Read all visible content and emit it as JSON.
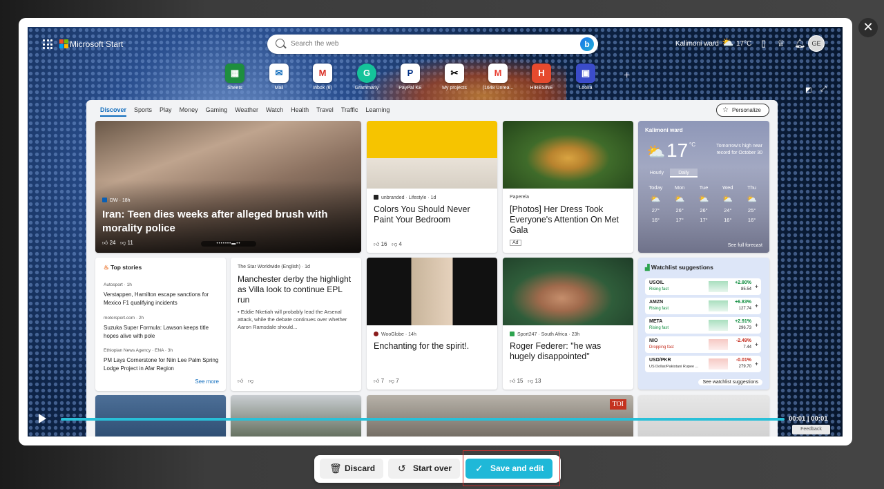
{
  "modal": {
    "close": "✕"
  },
  "topbar": {
    "brand": "Microsoft Start",
    "search_placeholder": "Search the web",
    "location": "Kalimoni ward",
    "temp": "17°C",
    "avatar": "GE"
  },
  "apps": [
    {
      "label": "Sheets",
      "glyph": "▦",
      "color": "#1e8e3e",
      "bg": "#fff"
    },
    {
      "label": "Mail",
      "glyph": "✉",
      "color": "#0f6cbd",
      "bg": "#fff"
    },
    {
      "label": "Inbox (6)",
      "glyph": "M",
      "color": "#d93025",
      "bg": "#fff"
    },
    {
      "label": "Grammarly",
      "glyph": "G",
      "color": "#fff",
      "bg": "#15c39a"
    },
    {
      "label": "PayPal KE",
      "glyph": "P",
      "color": "#003087",
      "bg": "#fff"
    },
    {
      "label": "My projects",
      "glyph": "✂",
      "color": "#000",
      "bg": "#fff"
    },
    {
      "label": "(1648 Unrea...",
      "glyph": "M",
      "color": "#e94235",
      "bg": "#fff"
    },
    {
      "label": "HIRESINE",
      "glyph": "H",
      "color": "#fff",
      "bg": "#e64a2e"
    },
    {
      "label": "Looka",
      "glyph": "▣",
      "color": "#fff",
      "bg": "#3b4cca"
    }
  ],
  "nav": {
    "tabs": [
      "Discover",
      "Sports",
      "Play",
      "Money",
      "Gaming",
      "Weather",
      "Watch",
      "Health",
      "Travel",
      "Traffic",
      "Learning"
    ],
    "personalize": "Personalize"
  },
  "hero": {
    "source": "DW · 18h",
    "title": "Iran: Teen dies weeks after alleged brush with morality police",
    "likes": "24",
    "dislikes": "11"
  },
  "cards": [
    {
      "source": "unbranded · Lifestyle · 1d",
      "title": "Colors You Should Never Paint Your Bedroom",
      "likes": "16",
      "dislikes": "4"
    },
    {
      "source": "Paperela",
      "title": "[Photos] Her Dress Took Everyone's Attention On Met Gala",
      "ad": "Ad"
    },
    {
      "source": "The Star Worldwide (English) · 1d",
      "title": "Manchester derby the highlight as Villa look to continue EPL run",
      "snippet": "• Eddie Nketiah will probably lead the Arsenal attack, while the debate continues over whether Aaron Ramsdale should..."
    },
    {
      "source": "WooGlobe · 14h",
      "title": "Enchanting for the spirit!.",
      "likes": "7",
      "dislikes": "7"
    },
    {
      "source": "Sport247 · South Africa · 23h",
      "title": "Roger Federer: \"he was hugely disappointed\"",
      "likes": "15",
      "dislikes": "13"
    }
  ],
  "weather": {
    "location": "Kalimoni ward",
    "temp": "17",
    "unit": "°C",
    "record": "Tomorrow's high near record for October 30",
    "tab_hourly": "Hourly",
    "tab_daily": "Daily",
    "days": [
      "Today",
      "Mon",
      "Tue",
      "Wed",
      "Thu"
    ],
    "highs": [
      "27°",
      "26°",
      "26°",
      "24°",
      "25°"
    ],
    "lows": [
      "16°",
      "17°",
      "17°",
      "16°",
      "16°"
    ],
    "forecast_link": "See full forecast"
  },
  "top_stories": {
    "title": "Top stories",
    "more": "See more",
    "items": [
      {
        "source": "Autosport · 1h",
        "text": "Verstappen, Hamilton escape sanctions for Mexico F1 qualifying incidents"
      },
      {
        "source": "motorsport.com · 2h",
        "text": "Suzuka Super Formula: Lawson keeps title hopes alive with pole"
      },
      {
        "source": "Ethiopian News Agency · ENA · 3h",
        "text": "PM Lays Cornerstone for Niin Lee Palm Spring Lodge Project in Afar Region"
      }
    ]
  },
  "watchlist": {
    "title": "Watchlist suggestions",
    "link": "See watchlist suggestions",
    "items": [
      {
        "sym": "USOIL",
        "status": "Rising fast",
        "pct": "+2.80%",
        "price": "85.54",
        "color": "#0a8a3a"
      },
      {
        "sym": "AMZN",
        "status": "Rising fast",
        "pct": "+6.83%",
        "price": "127.74",
        "color": "#0a8a3a"
      },
      {
        "sym": "META",
        "status": "Rising fast",
        "pct": "+2.91%",
        "price": "296.73",
        "color": "#0a8a3a"
      },
      {
        "sym": "NIO",
        "status": "Dropping fast",
        "pct": "-2.49%",
        "price": "7.44",
        "color": "#c42b1c"
      },
      {
        "sym": "USD/PKR",
        "status": "US Dollar/Pakistani Rupee ...",
        "pct": "-0.01%",
        "price": "279.70",
        "color": "#c42b1c"
      }
    ]
  },
  "video": {
    "time": "00:01 | 00:01",
    "feedback": "Feedback",
    "toi": "TOI",
    "progress_percent": 100
  },
  "toolbar": {
    "discard": "Discard",
    "start_over": "Start over",
    "save": "Save and edit"
  }
}
